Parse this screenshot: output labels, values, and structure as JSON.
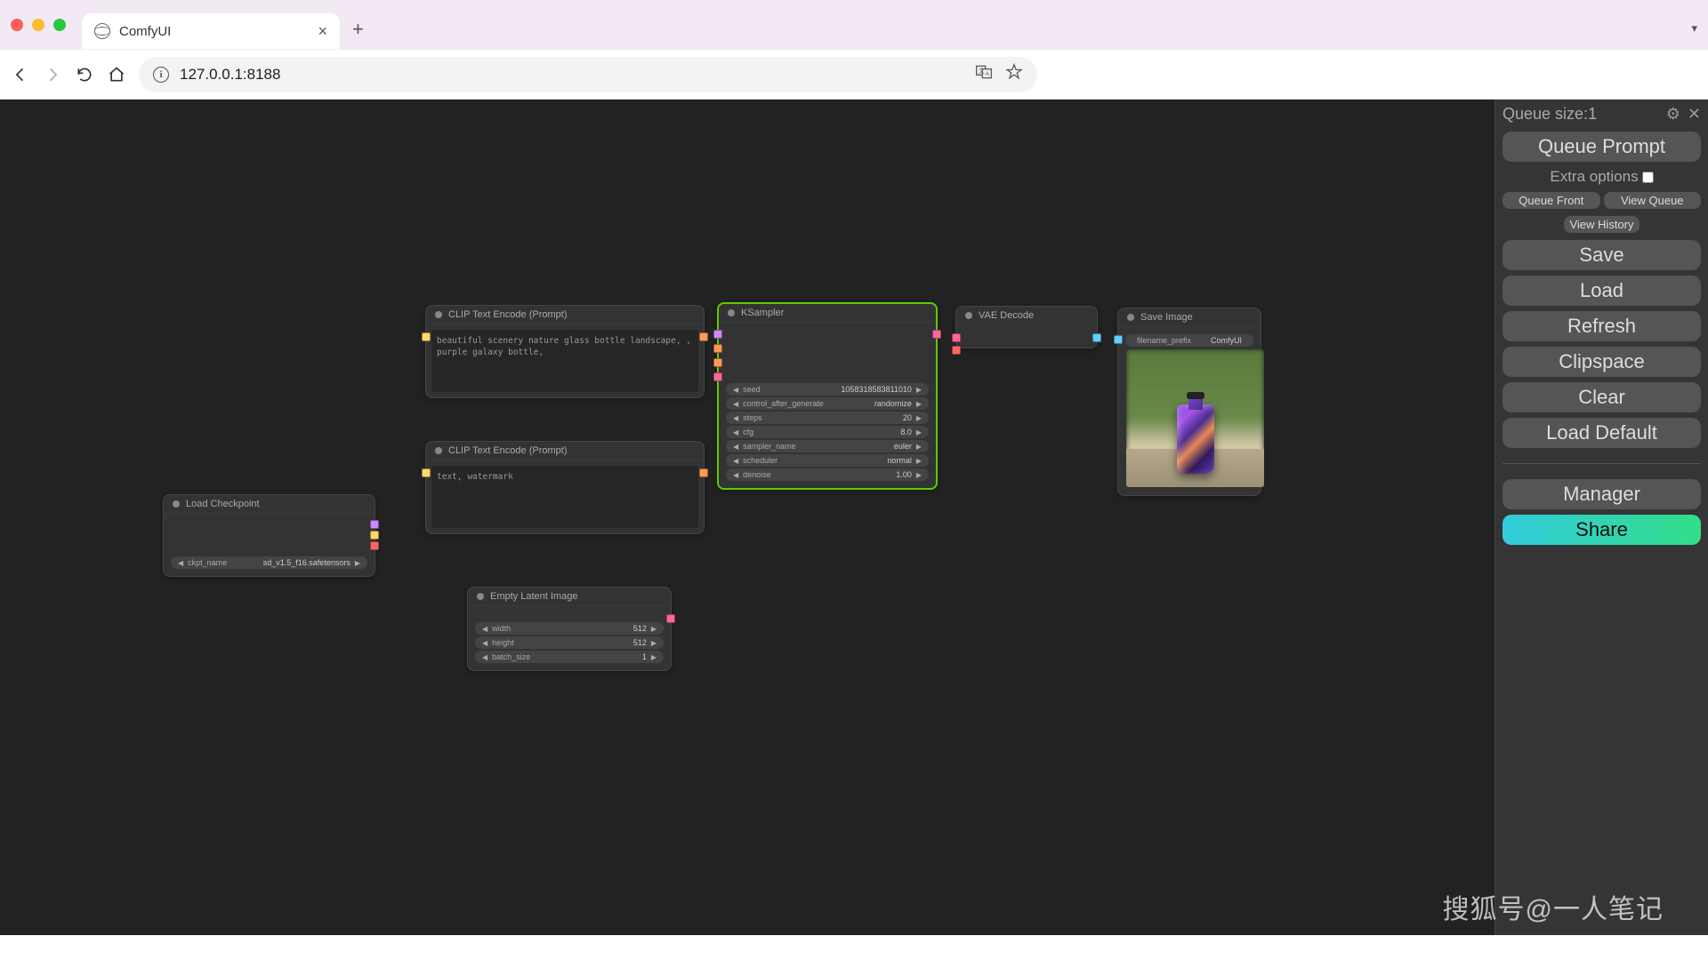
{
  "browser": {
    "tab_title": "ComfyUI",
    "url": "127.0.0.1:8188"
  },
  "sidebar": {
    "queue_label": "Queue size: ",
    "queue_size": "1",
    "buttons": {
      "queue_prompt": "Queue Prompt",
      "extra_options": "Extra options",
      "queue_front": "Queue Front",
      "view_queue": "View Queue",
      "view_history": "View History",
      "save": "Save",
      "load": "Load",
      "refresh": "Refresh",
      "clipspace": "Clipspace",
      "clear": "Clear",
      "load_default": "Load Default",
      "manager": "Manager",
      "share": "Share"
    }
  },
  "nodes": {
    "load_checkpoint": {
      "title": "Load Checkpoint",
      "param_label": "ckpt_name",
      "param_value": "sd_v1.5_f16.safetensors"
    },
    "clip_pos": {
      "title": "CLIP Text Encode (Prompt)",
      "text": "beautiful scenery nature glass bottle landscape, , purple galaxy bottle,"
    },
    "clip_neg": {
      "title": "CLIP Text Encode (Prompt)",
      "text": "text, watermark"
    },
    "empty_latent": {
      "title": "Empty Latent Image",
      "params": [
        {
          "label": "width",
          "value": "512"
        },
        {
          "label": "height",
          "value": "512"
        },
        {
          "label": "batch_size",
          "value": "1"
        }
      ]
    },
    "ksampler": {
      "title": "KSampler",
      "params": [
        {
          "label": "seed",
          "value": "1058318583811010"
        },
        {
          "label": "control_after_generate",
          "value": "randomize"
        },
        {
          "label": "steps",
          "value": "20"
        },
        {
          "label": "cfg",
          "value": "8.0"
        },
        {
          "label": "sampler_name",
          "value": "euler"
        },
        {
          "label": "scheduler",
          "value": "normal"
        },
        {
          "label": "denoise",
          "value": "1.00"
        }
      ]
    },
    "vae_decode": {
      "title": "VAE Decode"
    },
    "save_image": {
      "title": "Save Image",
      "param_label": "filename_prefix",
      "param_value": "ComfyUI"
    }
  },
  "watermark": "搜狐号@一人笔记"
}
